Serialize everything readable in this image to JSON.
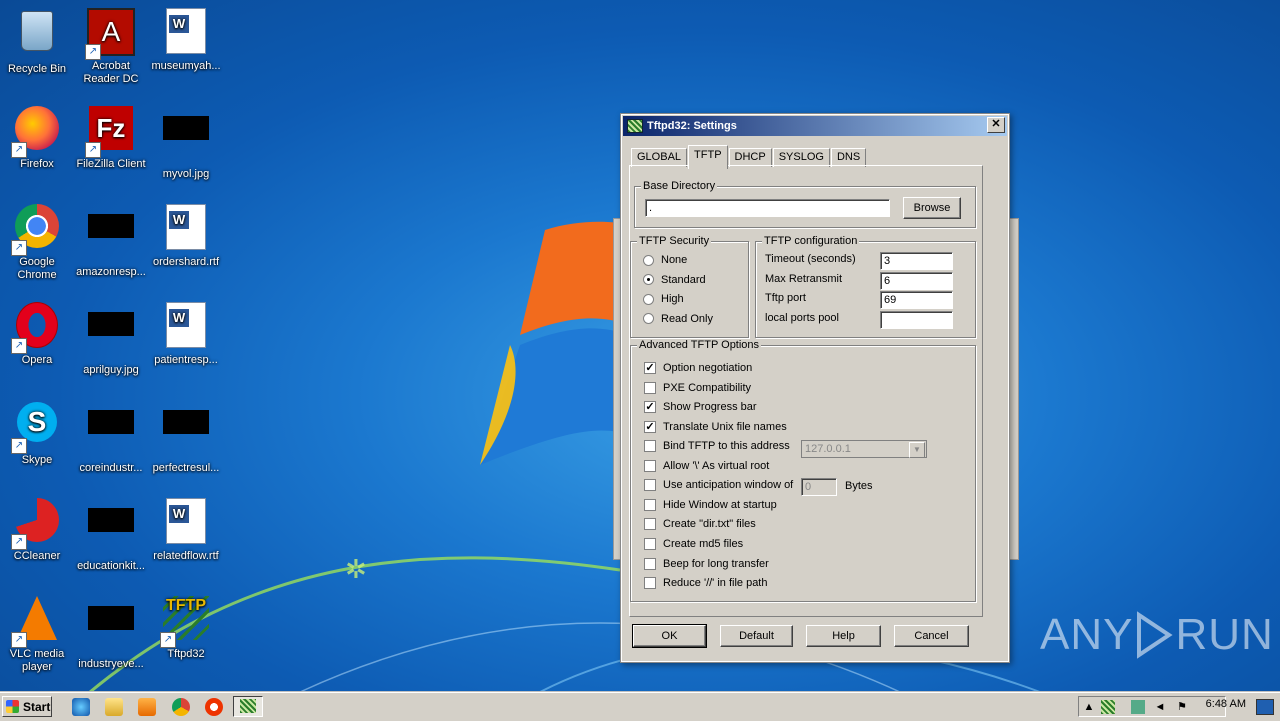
{
  "desktop": {
    "icons": [
      {
        "label": "Recycle Bin",
        "icon": "recycle-bin-icon"
      },
      {
        "label": "Acrobat Reader DC",
        "icon": "acrobat-icon"
      },
      {
        "label": "museumyah...",
        "icon": "word-doc-icon"
      },
      {
        "label": "Firefox",
        "icon": "firefox-icon"
      },
      {
        "label": "FileZilla Client",
        "icon": "filezilla-icon"
      },
      {
        "label": "myvol.jpg",
        "icon": "image-thumb-icon"
      },
      {
        "label": "Google Chrome",
        "icon": "chrome-icon"
      },
      {
        "label": "amazonresp...",
        "icon": "image-thumb-icon"
      },
      {
        "label": "ordershard.rtf",
        "icon": "word-doc-icon"
      },
      {
        "label": "Opera",
        "icon": "opera-icon"
      },
      {
        "label": "aprilguy.jpg",
        "icon": "image-thumb-icon"
      },
      {
        "label": "patientresp...",
        "icon": "word-doc-icon"
      },
      {
        "label": "Skype",
        "icon": "skype-icon"
      },
      {
        "label": "coreindustr...",
        "icon": "image-thumb-icon"
      },
      {
        "label": "perfectresul...",
        "icon": "image-thumb-icon"
      },
      {
        "label": "CCleaner",
        "icon": "ccleaner-icon"
      },
      {
        "label": "educationkit...",
        "icon": "image-thumb-icon"
      },
      {
        "label": "relatedflow.rtf",
        "icon": "word-doc-icon"
      },
      {
        "label": "VLC media player",
        "icon": "vlc-icon"
      },
      {
        "label": "industryeve...",
        "icon": "image-thumb-icon"
      },
      {
        "label": "Tftpd32",
        "icon": "tftpd-icon"
      }
    ]
  },
  "dialog": {
    "title": "Tftpd32: Settings",
    "close_glyph": "✕",
    "tabs": [
      "GLOBAL",
      "TFTP",
      "DHCP",
      "SYSLOG",
      "DNS"
    ],
    "active_tab": "TFTP",
    "base_directory": {
      "legend": "Base Directory",
      "value": ".",
      "browse_label": "Browse"
    },
    "security": {
      "legend": "TFTP Security",
      "options": [
        {
          "label": "None",
          "selected": false
        },
        {
          "label": "Standard",
          "selected": true
        },
        {
          "label": "High",
          "selected": false
        },
        {
          "label": "Read Only",
          "selected": false
        }
      ]
    },
    "configuration": {
      "legend": "TFTP configuration",
      "fields": [
        {
          "label": "Timeout (seconds)",
          "value": "3"
        },
        {
          "label": "Max Retransmit",
          "value": "6"
        },
        {
          "label": "Tftp port",
          "value": "69"
        },
        {
          "label": "local ports pool",
          "value": ""
        }
      ]
    },
    "advanced": {
      "legend": "Advanced TFTP Options",
      "options": [
        {
          "label": "Option negotiation",
          "checked": true
        },
        {
          "label": "PXE Compatibility",
          "checked": false
        },
        {
          "label": "Show Progress bar",
          "checked": true
        },
        {
          "label": "Translate Unix file names",
          "checked": true
        },
        {
          "label": "Bind TFTP to this address",
          "checked": false
        },
        {
          "label": "Allow '\\' As virtual root",
          "checked": false
        },
        {
          "label": "Use anticipation window of",
          "checked": false
        },
        {
          "label": "Hide Window at startup",
          "checked": false
        },
        {
          "label": "Create \"dir.txt\" files",
          "checked": false
        },
        {
          "label": "Create md5 files",
          "checked": false
        },
        {
          "label": "Beep for long transfer",
          "checked": false
        },
        {
          "label": "Reduce '//' in file path",
          "checked": false
        }
      ],
      "bind_address": "127.0.0.1",
      "anticipation_value": "0",
      "anticipation_unit": "Bytes"
    },
    "buttons": {
      "ok": "OK",
      "default": "Default",
      "help": "Help",
      "cancel": "Cancel"
    }
  },
  "taskbar": {
    "start_label": "Start",
    "clock": "6:48 AM"
  },
  "watermark": {
    "left": "ANY",
    "right": "RUN"
  }
}
